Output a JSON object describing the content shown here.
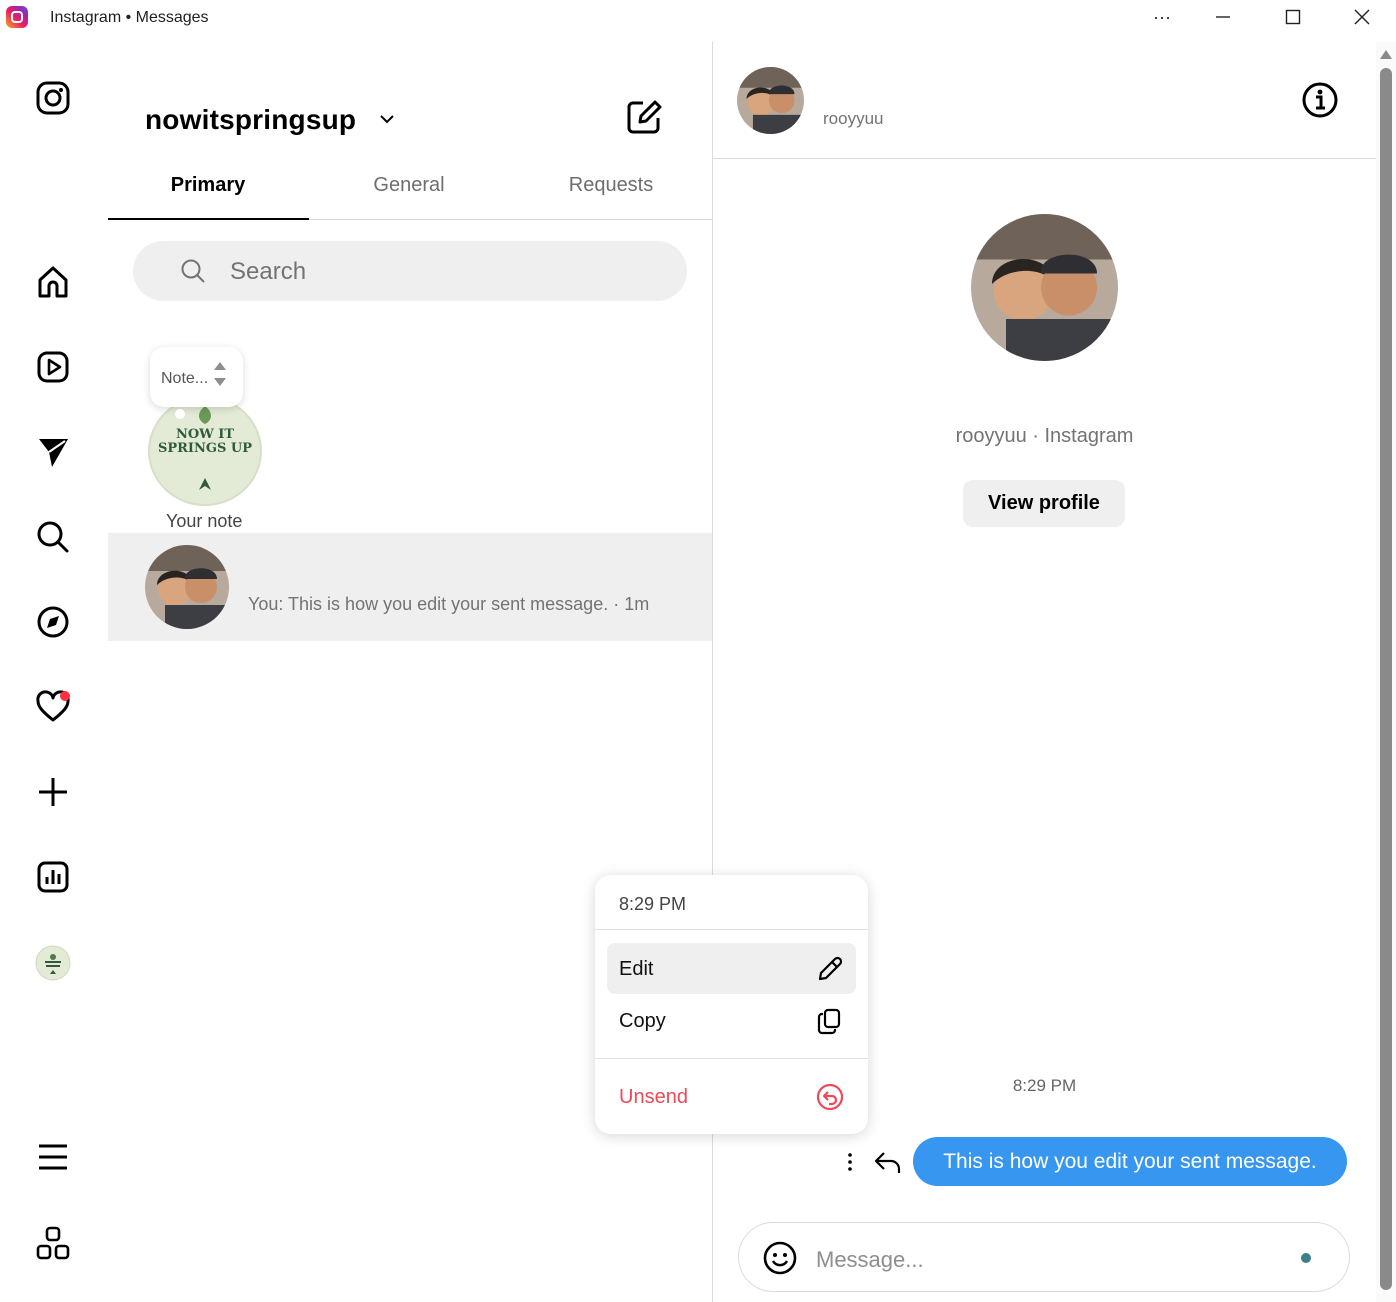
{
  "window": {
    "title": "Instagram • Messages",
    "more_label": "···"
  },
  "inbox": {
    "account_name": "nowitspringsup",
    "tabs": [
      {
        "label": "Primary",
        "active": true
      },
      {
        "label": "General",
        "active": false
      },
      {
        "label": "Requests",
        "active": false
      }
    ],
    "search_placeholder": "Search",
    "note": {
      "bubble_text": "Note...",
      "label": "Your note",
      "avatar_text": "NOW IT SPRINGS UP"
    },
    "conversations": [
      {
        "preview": "You: This is how you edit your sent message. · 1m",
        "selected": true
      }
    ]
  },
  "chat": {
    "username": "rooyyuu",
    "profile_subtitle": "rooyyuu · Instagram",
    "view_profile_label": "View profile",
    "message_time": "8:29 PM",
    "messages": [
      {
        "text": "This is how you edit your sent message.",
        "from_me": true
      }
    ],
    "composer_placeholder": "Message..."
  },
  "context_menu": {
    "time": "8:29 PM",
    "items": [
      {
        "label": "Edit",
        "icon": "pencil-icon",
        "highlighted": true
      },
      {
        "label": "Copy",
        "icon": "copy-icon",
        "highlighted": false
      },
      {
        "label": "Unsend",
        "icon": "unsend-icon",
        "destructive": true
      }
    ]
  },
  "colors": {
    "accent_blue": "#3797f0",
    "danger": "#ed4956",
    "notification_dot": "#ff3040"
  }
}
